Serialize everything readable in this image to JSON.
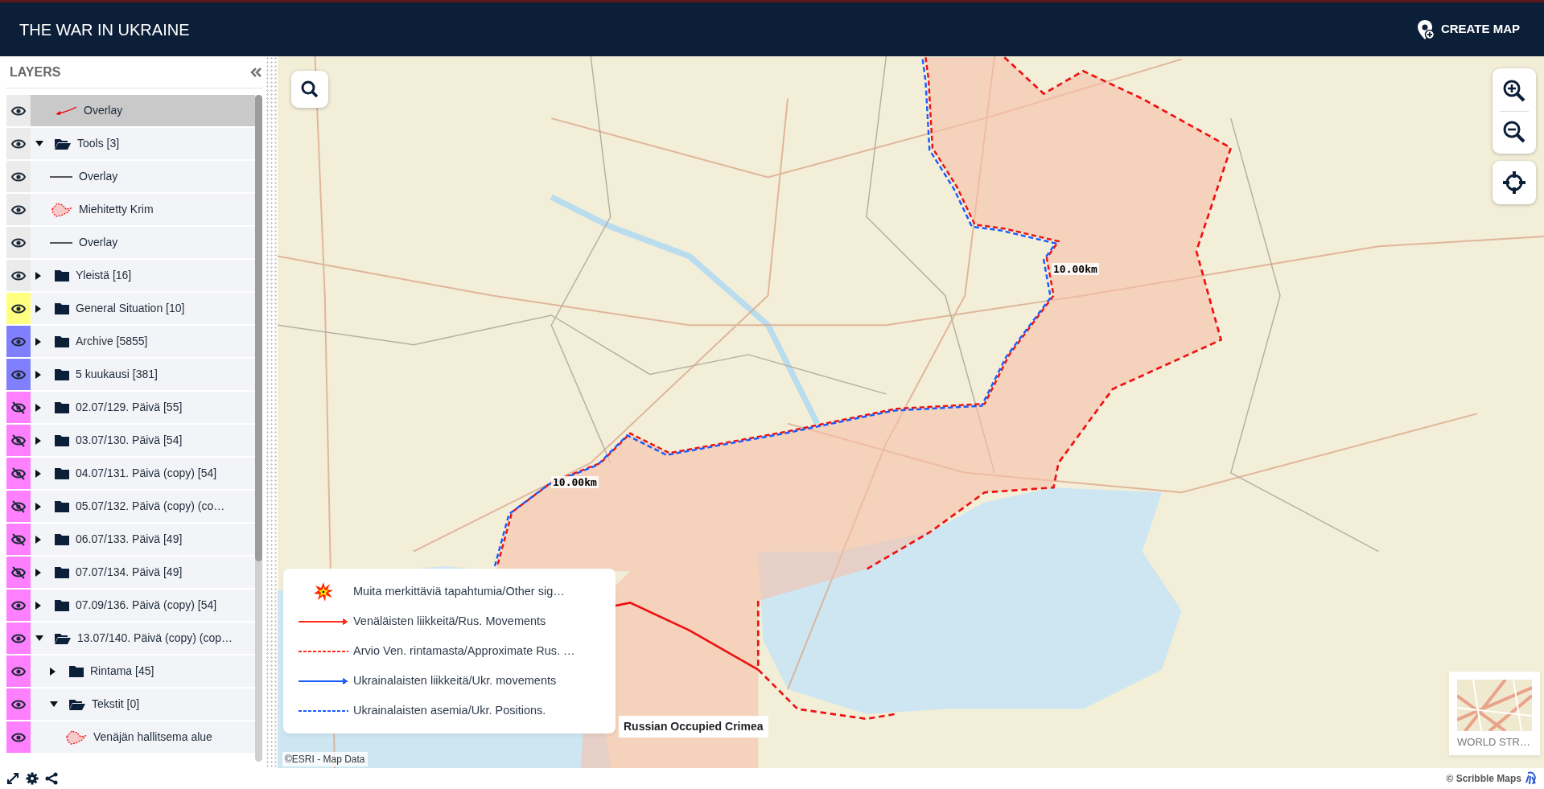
{
  "header": {
    "title": "THE WAR IN UKRAINE",
    "action": "CREATE MAP"
  },
  "layers_panel": {
    "title": "LAYERS",
    "items": [
      {
        "label": "Overlay",
        "kind": "arrow",
        "visible": true,
        "color": "#ebebeb",
        "selected": true
      },
      {
        "label": "Tools [3]",
        "kind": "folder",
        "visible": true,
        "color": "#ebebeb",
        "selected": false,
        "expanded": true,
        "children": [
          {
            "label": "Overlay",
            "kind": "line",
            "visible": true,
            "color": "#ebebeb",
            "selected": false
          },
          {
            "label": "Miehitetty Krim",
            "kind": "polygon",
            "visible": true,
            "color": "#ebebeb",
            "selected": false
          },
          {
            "label": "Overlay",
            "kind": "line",
            "visible": true,
            "color": "#ebebeb",
            "selected": false
          }
        ]
      },
      {
        "label": "Yleistä [16]",
        "kind": "folder",
        "visible": true,
        "color": "#ebebeb",
        "selected": false,
        "expanded": false
      },
      {
        "label": "General Situation [10]",
        "kind": "folder",
        "visible": true,
        "color": "#ffff80",
        "selected": false,
        "expanded": false
      },
      {
        "label": "Archive [5855]",
        "kind": "folder",
        "visible": true,
        "color": "#8080ff",
        "selected": false,
        "expanded": false
      },
      {
        "label": "5 kuukausi [381]",
        "kind": "folder",
        "visible": true,
        "color": "#8080ff",
        "selected": false,
        "expanded": false
      },
      {
        "label": "02.07/129. Päivä [55]",
        "kind": "folder",
        "visible": false,
        "color": "#ff80ff",
        "selected": false,
        "expanded": false
      },
      {
        "label": "03.07/130. Päivä [54]",
        "kind": "folder",
        "visible": false,
        "color": "#ff80ff",
        "selected": false,
        "expanded": false
      },
      {
        "label": "04.07/131. Päivä (copy) [54]",
        "kind": "folder",
        "visible": false,
        "color": "#ff80ff",
        "selected": false,
        "expanded": false
      },
      {
        "label": "05.07/132. Päivä (copy) (co…",
        "kind": "folder",
        "visible": false,
        "color": "#ff80ff",
        "selected": false,
        "expanded": false
      },
      {
        "label": "06.07/133. Päivä [49]",
        "kind": "folder",
        "visible": false,
        "color": "#ff80ff",
        "selected": false,
        "expanded": false
      },
      {
        "label": "07.07/134. Päivä [49]",
        "kind": "folder",
        "visible": false,
        "color": "#ff80ff",
        "selected": false,
        "expanded": false
      },
      {
        "label": "07.09/136. Päivä (copy) [54]",
        "kind": "folder",
        "visible": true,
        "color": "#ff80ff",
        "selected": false,
        "expanded": false
      },
      {
        "label": "13.07/140. Päivä (copy) (cop…",
        "kind": "folder",
        "visible": true,
        "color": "#ff80ff",
        "selected": false,
        "expanded": true,
        "children": [
          {
            "label": "Rintama [45]",
            "kind": "folder",
            "visible": true,
            "color": "#ff80ff",
            "selected": false,
            "expanded": false
          },
          {
            "label": "Tekstit [0]",
            "kind": "folder",
            "visible": true,
            "color": "#ff80ff",
            "selected": false,
            "expanded": true,
            "children": [
              {
                "label": "Venäjän hallitsema alue",
                "kind": "polygon",
                "visible": true,
                "color": "#ff80ff",
                "selected": false
              }
            ]
          }
        ]
      }
    ]
  },
  "map": {
    "scale_labels": [
      "10.00km",
      "10.00km"
    ],
    "region_label": "Russian Occupied Crimea",
    "attribution": "©ESRI - Map Data",
    "legend": [
      {
        "label": "Muita merkittäviä tapahtumia/Other sig…",
        "kind": "burst",
        "color": "#ff2a00"
      },
      {
        "label": "Venäläisten liikkeitä/Rus. Movements",
        "kind": "arrow",
        "color": "#ff2a1a"
      },
      {
        "label": "Arvio Ven. rintamasta/Approximate Rus. …",
        "kind": "dashed",
        "color": "#ff2a1a"
      },
      {
        "label": "Ukrainalaisten liikkeitä/Ukr. movements",
        "kind": "arrow",
        "color": "#1a5cff"
      },
      {
        "label": "Ukrainalaisten asemia/Ukr. Positions.",
        "kind": "dashed",
        "color": "#1a5cff"
      }
    ],
    "basemap": {
      "label": "WORLD STR…"
    }
  },
  "footer": {
    "credit": "© Scribble Maps"
  }
}
